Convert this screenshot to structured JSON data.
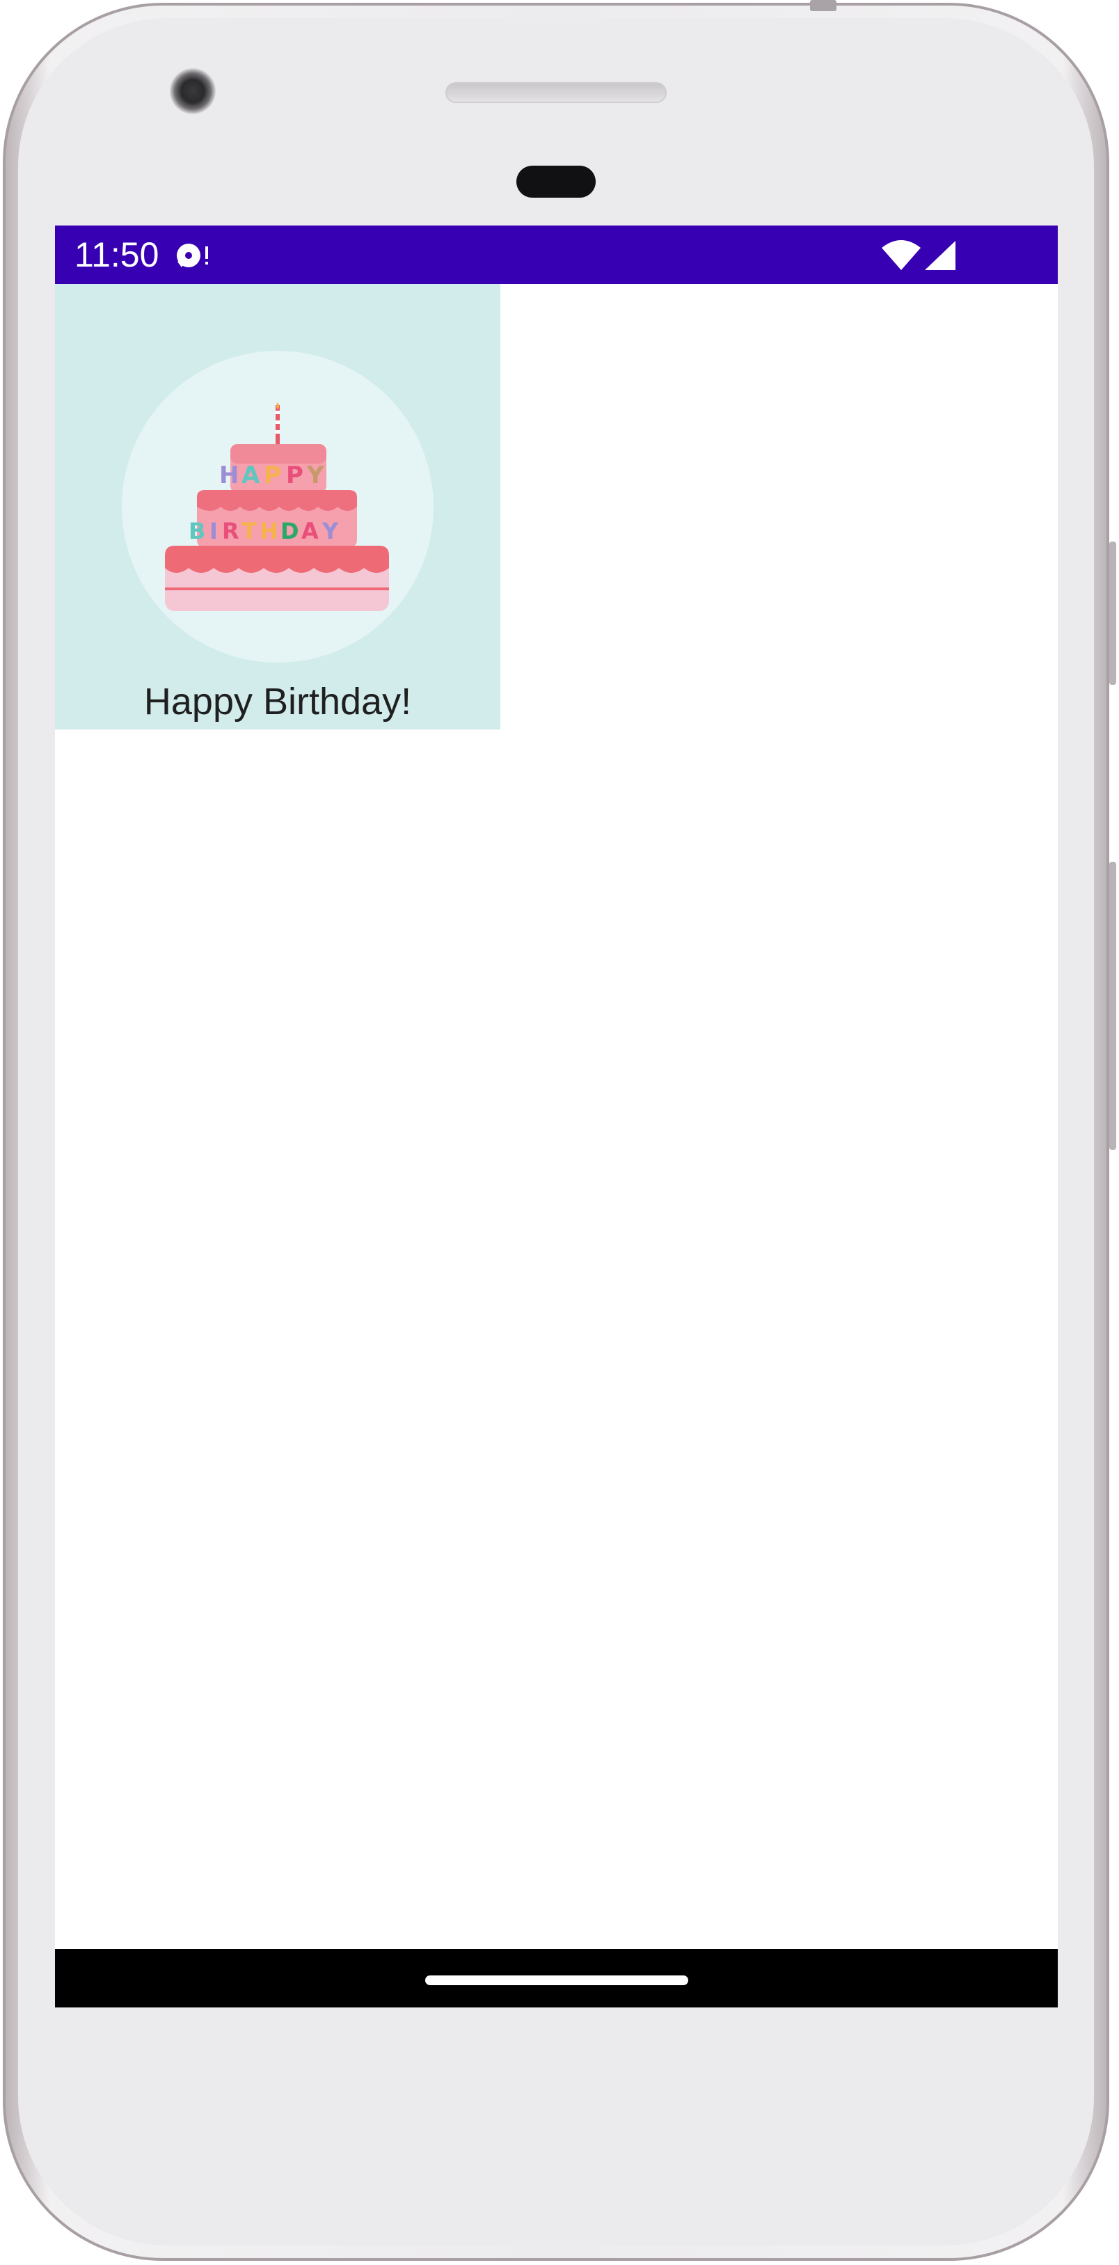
{
  "status_bar": {
    "time": "11:50",
    "background_color": "#3700b3",
    "notification_icon": "media-notification-icon",
    "wifi_icon": "wifi-icon",
    "signal_icon": "cell-signal-icon"
  },
  "card": {
    "background_color": "#d2ecec",
    "image_icon": "birthday-cake-icon",
    "title": "Happy Birthday!"
  },
  "navigation": {
    "home_handle_icon": "home-gesture-handle"
  }
}
